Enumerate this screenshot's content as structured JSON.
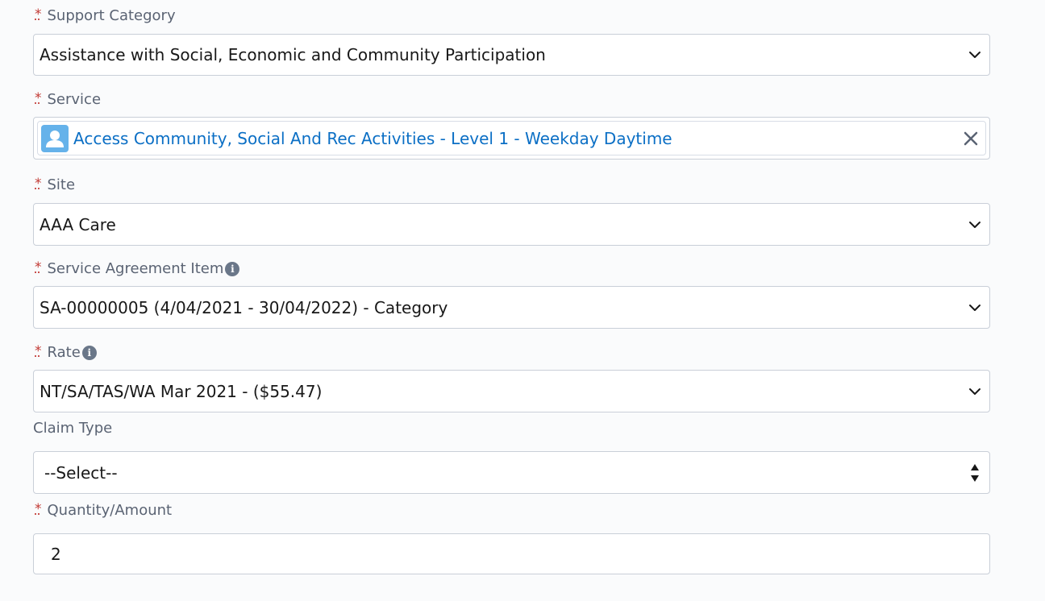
{
  "support_category": {
    "label": "Support Category",
    "value": "Assistance with Social, Economic and Community Participation"
  },
  "service": {
    "label": "Service",
    "value": "Access Community, Social And Rec Activities - Level 1 - Weekday Daytime"
  },
  "site": {
    "label": "Site",
    "value": "AAA Care"
  },
  "service_agreement_item": {
    "label": "Service Agreement Item",
    "value": "SA-00000005 (4/04/2021 - 30/04/2022) - Category"
  },
  "rate": {
    "label": "Rate",
    "value": "NT/SA/TAS/WA Mar 2021 - ($55.47)"
  },
  "claim_type": {
    "label": "Claim Type",
    "value": "--Select--"
  },
  "quantity_amount": {
    "label": "Quantity/Amount",
    "value": "2"
  },
  "required_marker": "*",
  "info_glyph": "i",
  "icons": {
    "chevron": "chevron-down-icon",
    "clear": "close-icon",
    "avatar": "user-icon",
    "info": "info-icon",
    "stepper": "sort-arrows-icon"
  },
  "colors": {
    "required": "#c23934",
    "link": "#0b6fc5",
    "avatar_bg": "#65b2ea",
    "info_bg": "#6a7789"
  }
}
